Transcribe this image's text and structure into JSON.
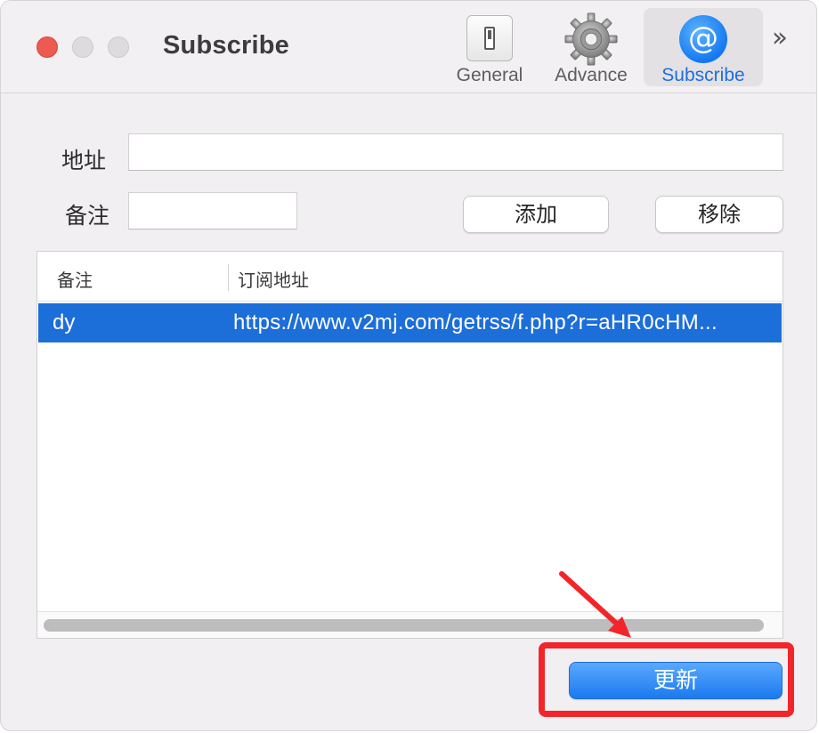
{
  "window": {
    "title": "Subscribe",
    "traffic_lights": [
      "close",
      "minimize",
      "zoom"
    ]
  },
  "toolbar": {
    "items": [
      {
        "label": "General",
        "icon": "switch-icon"
      },
      {
        "label": "Advance",
        "icon": "gear-icon"
      },
      {
        "label": "Subscribe",
        "icon": "at-sign-icon",
        "active": true
      }
    ],
    "overflow_icon": "chevron-double-right-icon"
  },
  "form": {
    "address_label": "地址",
    "address_value": "",
    "note_label": "备注",
    "note_value": "",
    "add_button": "添加",
    "remove_button": "移除"
  },
  "table": {
    "columns": [
      "备注",
      "订阅地址"
    ],
    "rows": [
      {
        "note": "dy",
        "url": "https://www.v2mj.com/getrss/f.php?r=aHR0cHM...",
        "selected": true
      }
    ]
  },
  "actions": {
    "update_button": "更新"
  },
  "colors": {
    "accent": "#1c6ed9",
    "annotation": "#f2262a",
    "close": "#ee5a52"
  }
}
